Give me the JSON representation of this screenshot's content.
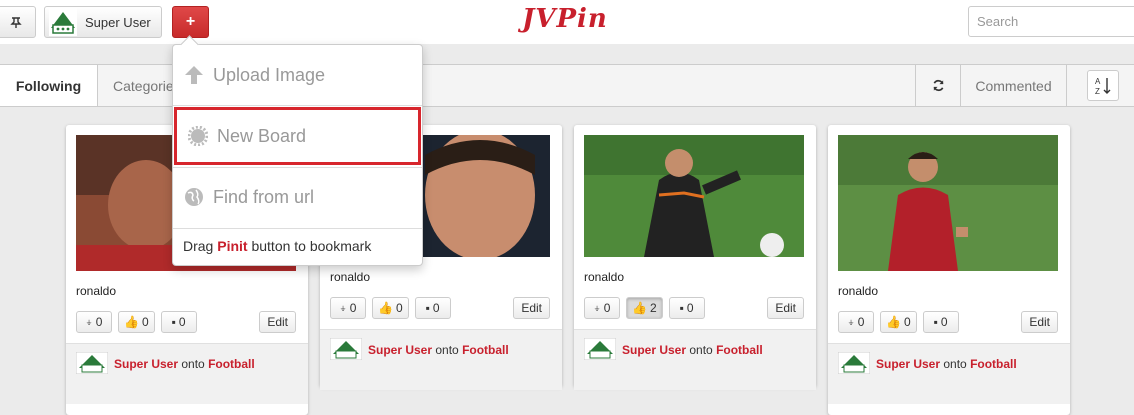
{
  "header": {
    "logo": "JVPin",
    "user_label": "Super User",
    "add_label": "+",
    "search_placeholder": "Search"
  },
  "subnav": {
    "following": "Following",
    "categories": "Categories",
    "commented": "Commented"
  },
  "dropdown": {
    "upload": "Upload Image",
    "new_board": "New Board",
    "find_url": "Find from url",
    "bookmark_pre": "Drag ",
    "bookmark_pinit": "Pinit",
    "bookmark_post": " button to bookmark"
  },
  "cards": [
    {
      "title": "ronaldo",
      "repins": "0",
      "likes": "0",
      "comments": "0",
      "edit": "Edit",
      "user": "Super User",
      "onto": " onto ",
      "board": "Football"
    },
    {
      "title": "ronaldo",
      "repins": "0",
      "likes": "0",
      "comments": "0",
      "edit": "Edit",
      "user": "Super User",
      "onto": " onto ",
      "board": "Football"
    },
    {
      "title": "ronaldo",
      "repins": "0",
      "likes": "2",
      "comments": "0",
      "edit": "Edit",
      "user": "Super User",
      "onto": " onto ",
      "board": "Football"
    },
    {
      "title": "ronaldo",
      "repins": "0",
      "likes": "0",
      "comments": "0",
      "edit": "Edit",
      "user": "Super User",
      "onto": " onto ",
      "board": "Football"
    }
  ],
  "colors": {
    "brand": "#c8202d",
    "highlight": "#d7262d"
  },
  "icons": [
    "pushpin-icon",
    "plus-icon",
    "upload-arrow-icon",
    "gear-icon",
    "globe-icon",
    "refresh-icon",
    "sort-az-icon",
    "thumbs-up-icon",
    "comment-icon"
  ]
}
